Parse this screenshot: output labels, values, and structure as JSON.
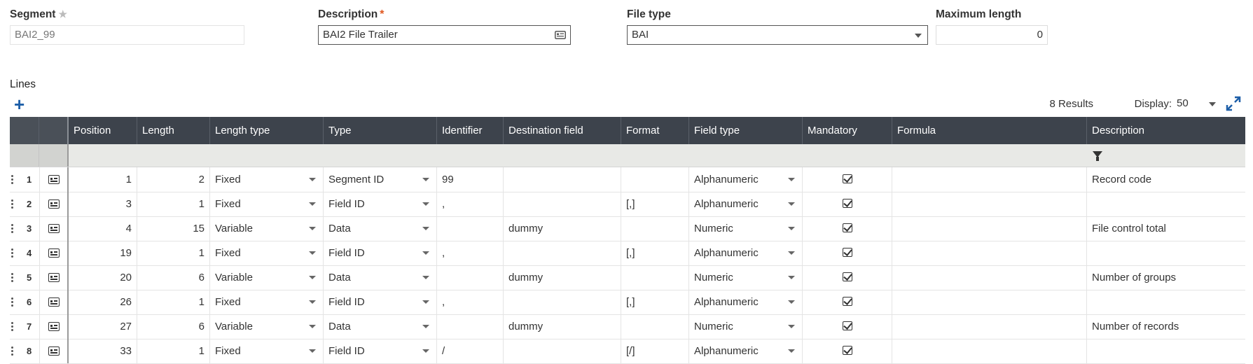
{
  "fields": {
    "segment": {
      "label": "Segment",
      "value": "BAI2_99"
    },
    "description": {
      "label": "Description",
      "value": "BAI2 File Trailer"
    },
    "file_type": {
      "label": "File type",
      "value": "BAI"
    },
    "maximum_length": {
      "label": "Maximum length",
      "value": "0"
    }
  },
  "lines": {
    "title": "Lines",
    "results": "8 Results",
    "display_label": "Display:",
    "display_value": "50",
    "columns": [
      "Position",
      "Length",
      "Length type",
      "Type",
      "Identifier",
      "Destination field",
      "Format",
      "Field type",
      "Mandatory",
      "Formula",
      "Description"
    ],
    "rows": [
      {
        "num": "1",
        "position": "1",
        "length": "2",
        "length_type": "Fixed",
        "type": "Segment ID",
        "identifier": "99",
        "destination": "",
        "format": "",
        "field_type": "Alphanumeric",
        "mandatory": true,
        "formula": "",
        "description": "Record code"
      },
      {
        "num": "2",
        "position": "3",
        "length": "1",
        "length_type": "Fixed",
        "type": "Field ID",
        "identifier": ",",
        "destination": "",
        "format": "[,]",
        "field_type": "Alphanumeric",
        "mandatory": true,
        "formula": "",
        "description": ""
      },
      {
        "num": "3",
        "position": "4",
        "length": "15",
        "length_type": "Variable",
        "type": "Data",
        "identifier": "",
        "destination": "dummy",
        "format": "",
        "field_type": "Numeric",
        "mandatory": true,
        "formula": "",
        "description": "File control total"
      },
      {
        "num": "4",
        "position": "19",
        "length": "1",
        "length_type": "Fixed",
        "type": "Field ID",
        "identifier": ",",
        "destination": "",
        "format": "[,]",
        "field_type": "Alphanumeric",
        "mandatory": true,
        "formula": "",
        "description": ""
      },
      {
        "num": "5",
        "position": "20",
        "length": "6",
        "length_type": "Variable",
        "type": "Data",
        "identifier": "",
        "destination": "dummy",
        "format": "",
        "field_type": "Numeric",
        "mandatory": true,
        "formula": "",
        "description": "Number of groups"
      },
      {
        "num": "6",
        "position": "26",
        "length": "1",
        "length_type": "Fixed",
        "type": "Field ID",
        "identifier": ",",
        "destination": "",
        "format": "[,]",
        "field_type": "Alphanumeric",
        "mandatory": true,
        "formula": "",
        "description": ""
      },
      {
        "num": "7",
        "position": "27",
        "length": "6",
        "length_type": "Variable",
        "type": "Data",
        "identifier": "",
        "destination": "dummy",
        "format": "",
        "field_type": "Numeric",
        "mandatory": true,
        "formula": "",
        "description": "Number of records"
      },
      {
        "num": "8",
        "position": "33",
        "length": "1",
        "length_type": "Fixed",
        "type": "Field ID",
        "identifier": "/",
        "destination": "",
        "format": "[/]",
        "field_type": "Alphanumeric",
        "mandatory": true,
        "formula": "",
        "description": ""
      }
    ]
  }
}
